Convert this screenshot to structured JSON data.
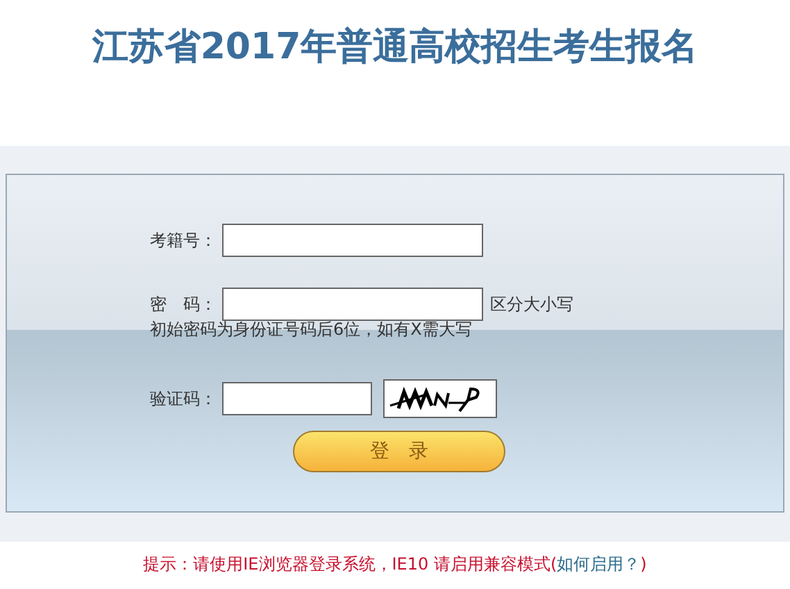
{
  "title": "江苏省2017年普通高校招生考生报名",
  "fields": [
    {
      "label": "考籍号：",
      "kind": "text"
    },
    {
      "label": "密　码：",
      "kind": "password",
      "note": "区分大小写",
      "hint": "初始密码为身份证号码后6位，如有X需大写"
    },
    {
      "label": "验证码：",
      "kind": "captcha"
    }
  ],
  "login_button": "登　录",
  "notice": {
    "text": "提示：请使用IE浏览器登录系统，IE10 请启用兼容模式(",
    "link": "如何启用？",
    "close": ")"
  }
}
